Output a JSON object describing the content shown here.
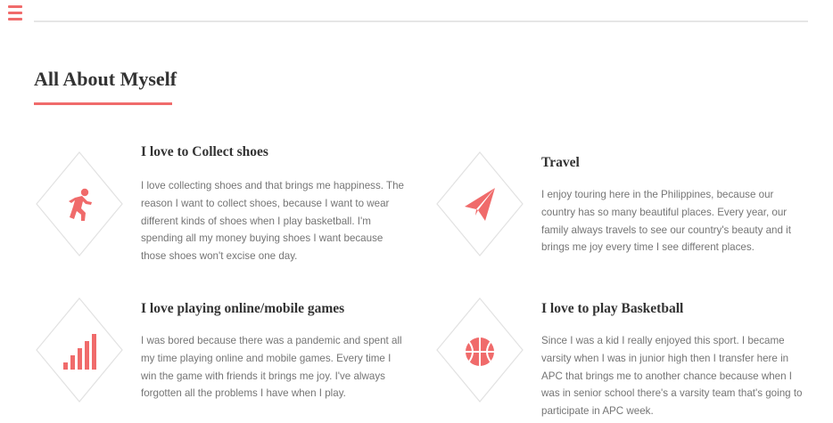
{
  "header": {
    "menu_icon": "hamburger-menu-icon",
    "accent_color": "#f06b6b"
  },
  "section": {
    "title": "All About Myself"
  },
  "cards": [
    {
      "icon": "running-person-icon",
      "title": "I love to Collect shoes",
      "text": "I love collecting shoes and that brings me happiness. The reason I want to collect shoes, because I want to wear different kinds of shoes when I play basketball. I'm spending all my money buying shoes I want because those shoes won't excise one day."
    },
    {
      "icon": "paper-plane-icon",
      "title": "Travel",
      "text": "I enjoy touring here in the Philippines, because our country has so many beautiful places. Every year, our family always travels to see our country's beauty and it brings me joy every time I see different places."
    },
    {
      "icon": "signal-bars-icon",
      "title": "I love playing online/mobile games",
      "text": "I was bored because there was a pandemic and spent all my time playing online and mobile games. Every time I win the game with friends it brings me joy. I've always forgotten all the problems I have when I play."
    },
    {
      "icon": "basketball-icon",
      "title": "I love to play Basketball",
      "text": "Since I was a kid I really enjoyed this sport. I became varsity when I was in junior high then I transfer here in APC that brings me to another chance because when I was in senior school there's a varsity team that's going to participate in APC week."
    }
  ]
}
